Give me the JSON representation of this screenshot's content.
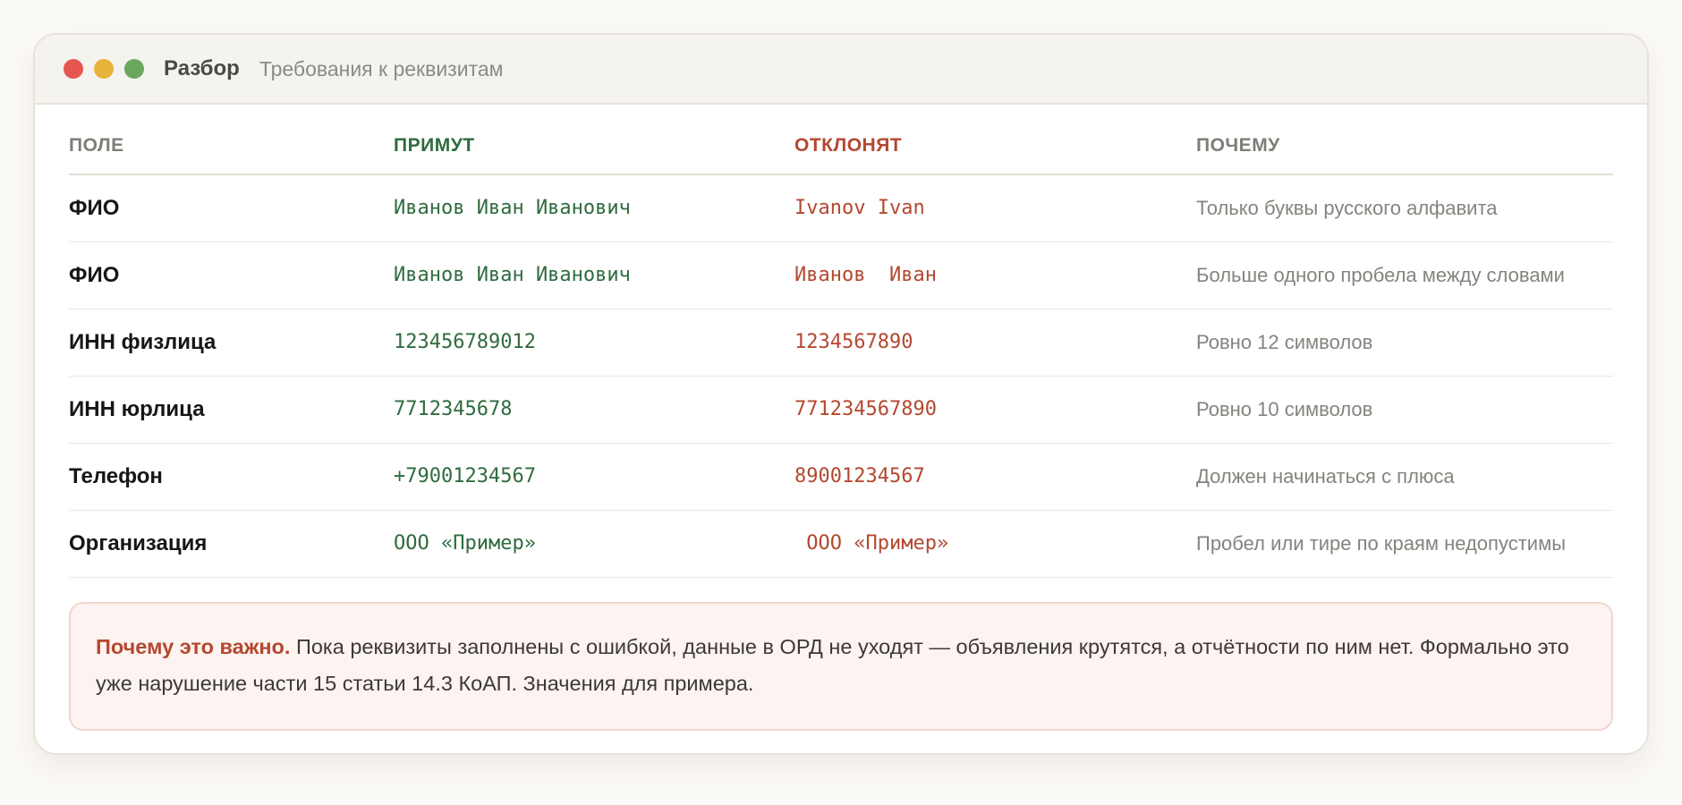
{
  "window": {
    "title": "Разбор",
    "subtitle": "Требования к реквизитам",
    "controls": [
      "close",
      "minimize",
      "maximize"
    ]
  },
  "colors": {
    "accept": "#2f6b3e",
    "reject": "#b3482f",
    "muted": "#85837d",
    "close": "#e5564f",
    "minimize": "#e8b33a",
    "maximize": "#6aa75c"
  },
  "table": {
    "headers": {
      "field": "ПОЛЕ",
      "accept": "ПРИМУТ",
      "reject": "ОТКЛОНЯТ",
      "why": "ПОЧЕМУ"
    },
    "rows": [
      {
        "field": "ФИО",
        "accept": "Иванов Иван Иванович",
        "reject": "Ivanov Ivan",
        "why": "Только буквы русского алфавита"
      },
      {
        "field": "ФИО",
        "accept": "Иванов Иван Иванович",
        "reject": "Иванов  Иван",
        "why": "Больше одного пробела между словами"
      },
      {
        "field": "ИНН физлица",
        "accept": "123456789012",
        "reject": "1234567890",
        "why": "Ровно 12 символов"
      },
      {
        "field": "ИНН юрлица",
        "accept": "7712345678",
        "reject": "771234567890",
        "why": "Ровно 10 символов"
      },
      {
        "field": "Телефон",
        "accept": "+79001234567",
        "reject": "89001234567",
        "why": "Должен начинаться с плюса"
      },
      {
        "field": "Организация",
        "accept": "ООО «Пример»",
        "reject": " ООО «Пример»",
        "why": "Пробел или тире по краям недопустимы"
      }
    ]
  },
  "note": {
    "strong": "Почему это важно.",
    "text": " Пока реквизиты заполнены с ошибкой, данные в ОРД не уходят — объявления крутятся, а отчётности по ним нет. Формально это уже нарушение части 15 статьи 14.3 КоАП. Значения для примера."
  }
}
